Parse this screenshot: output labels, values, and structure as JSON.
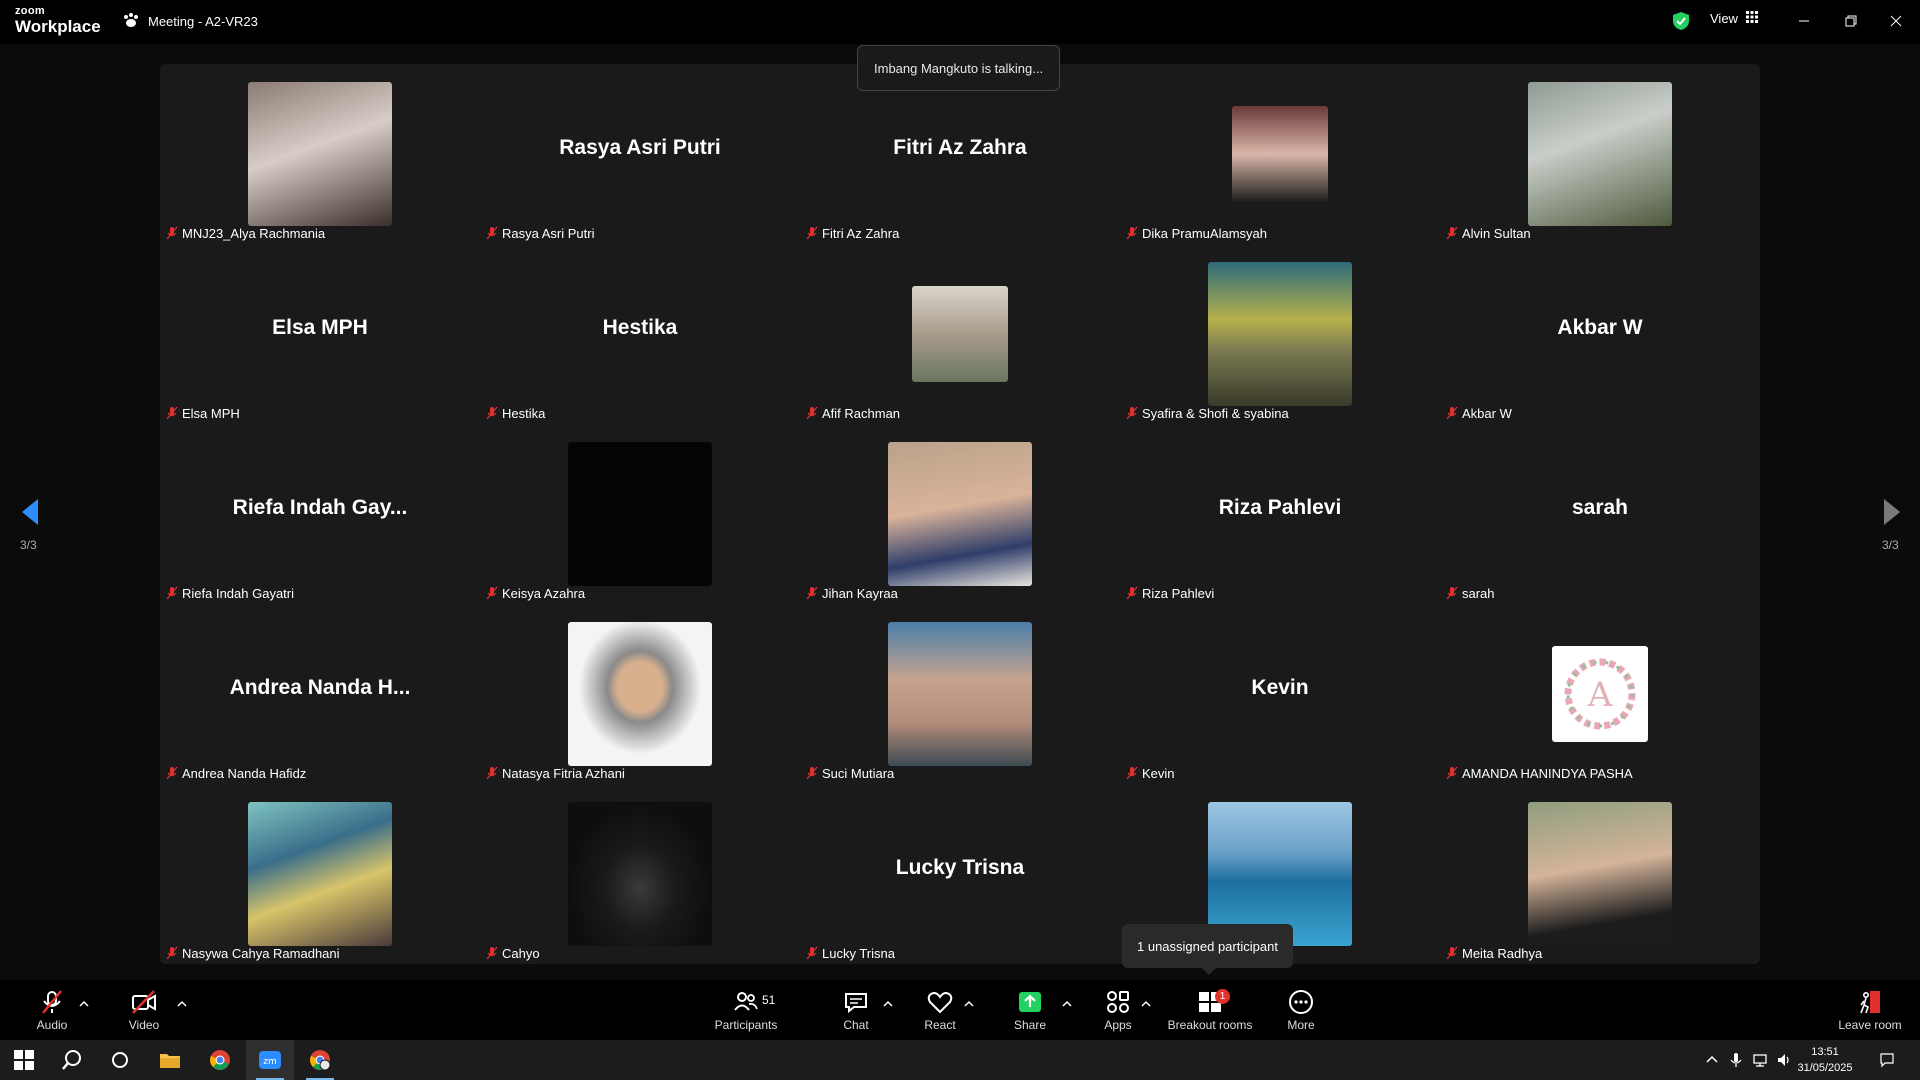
{
  "window": {
    "brand_line1": "zoom",
    "brand_line2": "Workplace",
    "title": "Meeting - A2-VR23",
    "view_label": "View"
  },
  "speaking_banner": "Imbang Mangkuto is talking...",
  "pager": {
    "left": "3/3",
    "right": "3/3"
  },
  "participants": [
    {
      "label": "MNJ23_Alya Rachmania",
      "display": "",
      "muted": true
    },
    {
      "label": "Rasya Asri Putri",
      "display": "Rasya Asri Putri",
      "muted": true
    },
    {
      "label": "Fitri Az Zahra",
      "display": "Fitri Az Zahra",
      "muted": true
    },
    {
      "label": "Dika PramuAlamsyah",
      "display": "",
      "muted": true
    },
    {
      "label": "Alvin Sultan",
      "display": "",
      "muted": true
    },
    {
      "label": "Elsa MPH",
      "display": "Elsa MPH",
      "muted": true
    },
    {
      "label": "Hestika",
      "display": "Hestika",
      "muted": true
    },
    {
      "label": "Afif Rachman",
      "display": "",
      "muted": true
    },
    {
      "label": "Syafira & Shofi & syabina",
      "display": "",
      "muted": true
    },
    {
      "label": "Akbar W",
      "display": "Akbar W",
      "muted": true
    },
    {
      "label": "Riefa Indah Gayatri",
      "display": "Riefa Indah Gay...",
      "muted": true
    },
    {
      "label": "Keisya Azahra",
      "display": "",
      "muted": true
    },
    {
      "label": "Jihan Kayraa",
      "display": "",
      "muted": true
    },
    {
      "label": "Riza Pahlevi",
      "display": "Riza Pahlevi",
      "muted": true
    },
    {
      "label": "sarah",
      "display": "sarah",
      "muted": true
    },
    {
      "label": "Andrea Nanda Hafidz",
      "display": "Andrea Nanda H...",
      "muted": true
    },
    {
      "label": "Natasya Fitria Azhani",
      "display": "",
      "muted": true
    },
    {
      "label": "Suci Mutiara",
      "display": "",
      "muted": true
    },
    {
      "label": "Kevin",
      "display": "Kevin",
      "muted": true
    },
    {
      "label": "AMANDA HANINDYA PASHA",
      "display": "",
      "muted": true
    },
    {
      "label": "Nasywa Cahya Ramadhani",
      "display": "",
      "muted": true
    },
    {
      "label": "Cahyo",
      "display": "",
      "muted": true
    },
    {
      "label": "Lucky Trisna",
      "display": "Lucky Trisna",
      "muted": true
    },
    {
      "label": "",
      "display": "",
      "muted": false
    },
    {
      "label": "Meita Radhya",
      "display": "",
      "muted": true
    }
  ],
  "tooltip": "1 unassigned participant",
  "toolbar": {
    "audio": "Audio",
    "video": "Video",
    "participants": "Participants",
    "participants_count": "51",
    "chat": "Chat",
    "react": "React",
    "share": "Share",
    "apps": "Apps",
    "breakout": "Breakout rooms",
    "breakout_badge": "1",
    "more": "More",
    "leave": "Leave room"
  },
  "taskbar": {
    "time": "13:51",
    "date": "31/05/2025"
  },
  "colors": {
    "accent_blue": "#2d8cff",
    "share_green": "#23d160",
    "mute_red": "#e0312d",
    "tile_bg": "#1a1a1a"
  }
}
